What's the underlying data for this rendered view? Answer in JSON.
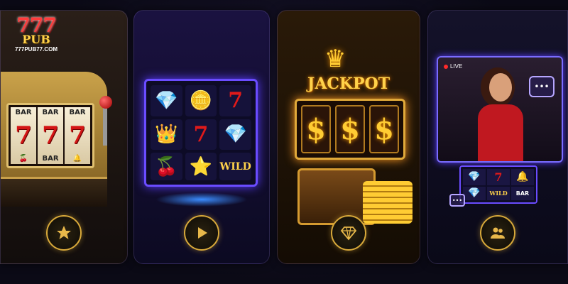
{
  "brand": {
    "mark": "777",
    "name": "PUB",
    "domain": "777PUB77.COM"
  },
  "cards": [
    {
      "id": "classic-slots",
      "icon": "star-icon",
      "reels": [
        {
          "top": "BAR",
          "mid": "7",
          "bottom": "🍒"
        },
        {
          "top": "BAR",
          "mid": "7",
          "bottom": "BAR"
        },
        {
          "top": "BAR",
          "mid": "7",
          "bottom": "🔔"
        }
      ]
    },
    {
      "id": "video-slots",
      "icon": "play-icon",
      "grid": [
        "💎",
        "🪙",
        "7",
        "👑",
        "7",
        "💎",
        "🍒",
        "⭐",
        "WILD"
      ]
    },
    {
      "id": "jackpot",
      "icon": "diamond-icon",
      "title": "JACKPOT",
      "symbols": [
        "$",
        "$",
        "$"
      ]
    },
    {
      "id": "live-casino",
      "icon": "users-icon",
      "live_label": "LIVE",
      "chat": "•••",
      "grid": [
        "💎",
        "7",
        "🔔",
        "💎",
        "WILD",
        "BAR"
      ]
    }
  ],
  "colors": {
    "accent_gold": "#d8a93a",
    "neon_purple": "#6a4cff"
  }
}
